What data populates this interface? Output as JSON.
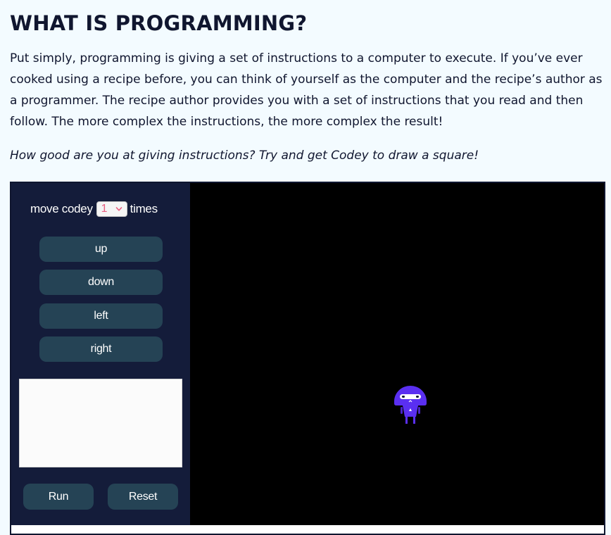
{
  "page": {
    "title": "WHAT IS PROGRAMMING?",
    "intro": "Put simply, programming is giving a set of instructions to a computer to execute. If you’ve ever cooked using a recipe before, you can think of yourself as the computer and the recipe’s author as a programmer. The recipe author provides you with a set of instructions that you read and then follow. The more complex the instructions, the more complex the result!",
    "prompt": "How good are you at giving instructions? Try and get Codey to draw a square!"
  },
  "controls": {
    "move_prefix": "move codey",
    "move_suffix": "times",
    "steps_value": "1",
    "steps_chevron_icon": "chevron-down-icon",
    "directions": [
      "up",
      "down",
      "left",
      "right"
    ],
    "program_text": "",
    "run_label": "Run",
    "reset_label": "Reset"
  },
  "stage": {
    "character_icon": "codey-robot-icon"
  },
  "colors": {
    "page_background": "#f3fbff",
    "text": "#10162f",
    "panel_background": "#141c3a",
    "button_background": "#254355",
    "stage_background": "#000000",
    "codey_purple": "#5a2ff1",
    "select_value": "#e85d7f"
  }
}
